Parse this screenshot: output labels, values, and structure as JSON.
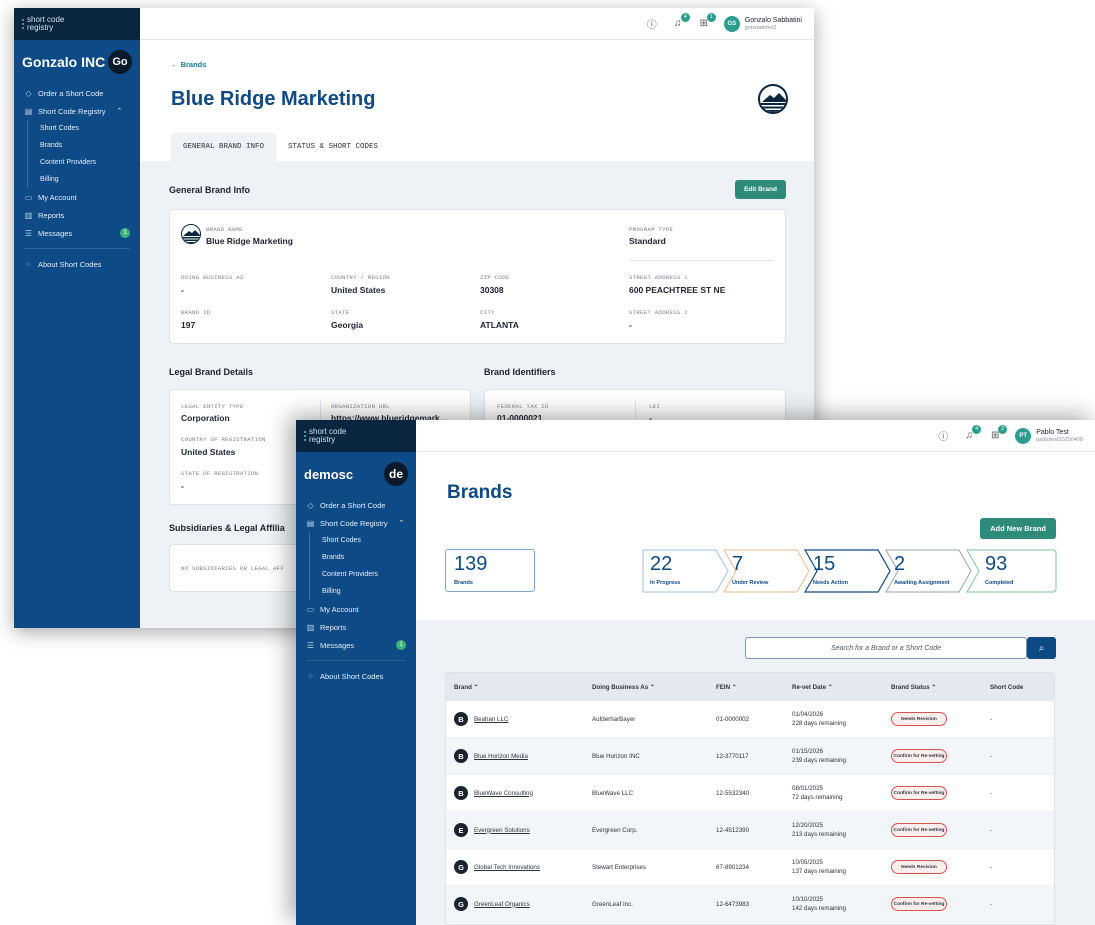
{
  "back_window": {
    "sidebar": {
      "logo_line1": "short code",
      "logo_line2": "registry",
      "org_name": "Gonzalo INC",
      "org_avatar": "Go",
      "nav": [
        {
          "label": "Order a Short Code",
          "icon": "tag-icon"
        },
        {
          "label": "Short Code Registry",
          "icon": "registry-icon"
        },
        {
          "label": "My Account",
          "icon": "chat-icon"
        },
        {
          "label": "Reports",
          "icon": "bar-chart-icon"
        },
        {
          "label": "Messages",
          "icon": "list-icon",
          "badge": "1"
        },
        {
          "label": "About Short Codes",
          "icon": "dots-icon"
        }
      ],
      "subnav": [
        "Short Codes",
        "Brands",
        "Content Providers",
        "Billing"
      ]
    },
    "header": {
      "notif_count": "4",
      "cart_count": "1",
      "user_initials": "GS",
      "user_name": "Gonzalo Sabbatini",
      "user_email": "gonzademo2"
    },
    "back_link": "← Brands",
    "title": "Blue Ridge Marketing",
    "tabs": [
      "GENERAL BRAND INFO",
      "STATUS & SHORT CODES"
    ],
    "general": {
      "section_title": "General Brand Info",
      "edit_button": "Edit Brand",
      "brand_name_label": "BRAND NAME",
      "brand_name": "Blue Ridge Marketing",
      "program_type_label": "PROGRAM TYPE",
      "program_type": "Standard",
      "fields": [
        {
          "label": "DOING BUSINESS AS",
          "value": "-"
        },
        {
          "label": "COUNTRY / REGION",
          "value": "United States"
        },
        {
          "label": "ZIP CODE",
          "value": "30308"
        },
        {
          "label": "STREET ADDRESS 1",
          "value": "600 PEACHTREE ST NE"
        },
        {
          "label": "BRAND ID",
          "value": "197"
        },
        {
          "label": "STATE",
          "value": "Georgia"
        },
        {
          "label": "CITY",
          "value": "ATLANTA"
        },
        {
          "label": "STREET ADDRESS 2",
          "value": "-"
        }
      ]
    },
    "legal": {
      "section_title": "Legal Brand Details",
      "fields": [
        {
          "label": "LEGAL ENTITY TYPE",
          "value": "Corporation"
        },
        {
          "label": "ORGANIZATION URL",
          "value": "https://www.blueridgemark..."
        },
        {
          "label": "COUNTRY OF REGISTRATION",
          "value": "United States"
        },
        {
          "label": "STATE OF REGISTRATION",
          "value": "-"
        }
      ]
    },
    "identifiers": {
      "section_title": "Brand Identifiers",
      "fields": [
        {
          "label": "FEDERAL TAX ID",
          "value": "01-0000021"
        },
        {
          "label": "LEI",
          "value": "-"
        }
      ]
    },
    "subsidiaries": {
      "section_title": "Subsidiaries & Legal Affilia",
      "empty_text": "NO SUBSIDIARIES OR LEGAL AFF"
    }
  },
  "front_window": {
    "sidebar": {
      "logo_line1": "short code",
      "logo_line2": "registry",
      "org_name": "demosc",
      "org_avatar": "de",
      "nav": [
        {
          "label": "Order a Short Code",
          "icon": "tag-icon"
        },
        {
          "label": "Short Code Registry",
          "icon": "registry-icon"
        },
        {
          "label": "My Account",
          "icon": "chat-icon"
        },
        {
          "label": "Reports",
          "icon": "bar-chart-icon"
        },
        {
          "label": "Messages",
          "icon": "list-icon",
          "badge": "1"
        },
        {
          "label": "About Short Codes",
          "icon": "dots-icon"
        }
      ],
      "subnav": [
        "Short Codes",
        "Brands",
        "Content Providers",
        "Billing"
      ]
    },
    "header": {
      "notif_count": "4",
      "cart_count": "2",
      "user_initials": "PT",
      "user_name": "Pablo Test",
      "user_email": "pablotest20250408"
    },
    "title": "Brands",
    "add_button": "Add New Brand",
    "stats": [
      {
        "number": "139",
        "label": "Brands",
        "color": "#7fa6cc"
      },
      {
        "number": "22",
        "label": "In Progress",
        "color": "#9ec3e0"
      },
      {
        "number": "7",
        "label": "Under Review",
        "color": "#e8b98f"
      },
      {
        "number": "15",
        "label": "Needs Action",
        "color": "#0d4a86"
      },
      {
        "number": "2",
        "label": "Awaiting Assignment",
        "color": "#9aa3ad"
      },
      {
        "number": "93",
        "label": "Completed",
        "color": "#7cc49a"
      }
    ],
    "search_placeholder": "Search for a Brand or a Short Code",
    "table": {
      "columns": [
        "Brand ⌃",
        "Doing Business As ⌃",
        "FEIN ⌃",
        "Re-vet Date ⌃",
        "Brand Status ⌃",
        "Short Code"
      ],
      "rows": [
        {
          "initial": "B",
          "brand": "Beahan LLC",
          "dba": "AufderharBayer",
          "fein": "01-0000002",
          "date": "01/04/2026",
          "remaining": "228 days remaining",
          "status": "Needs Revision",
          "code": "-"
        },
        {
          "initial": "B",
          "brand": "Blue Horizon Media",
          "dba": "Blue Horizon INC",
          "fein": "12-3770117",
          "date": "01/15/2026",
          "remaining": "239 days remaining",
          "status": "Confirm for Re-vetting",
          "code": "-"
        },
        {
          "initial": "B",
          "brand": "BlueWave Consulting",
          "dba": "BlueWave LLC",
          "fein": "12-5532340",
          "date": "08/01/2025",
          "remaining": "72 days remaining",
          "status": "Confirm for Re-vetting",
          "code": "-"
        },
        {
          "initial": "E",
          "brand": "Evergreen Solutions",
          "dba": "Evergreen Corp.",
          "fein": "12-4512390",
          "date": "12/20/2025",
          "remaining": "213 days remaining",
          "status": "Confirm for Re-vetting",
          "code": "-"
        },
        {
          "initial": "G",
          "brand": "Global Tech Innovations",
          "dba": "Stewart Enterprises",
          "fein": "67-8901234",
          "date": "10/05/2025",
          "remaining": "137 days remaining",
          "status": "Needs Revision",
          "code": "-"
        },
        {
          "initial": "G",
          "brand": "GreenLeaf Organics",
          "dba": "GreenLeaf Inc.",
          "fein": "12-6473983",
          "date": "10/10/2025",
          "remaining": "142 days remaining",
          "status": "Confirm for Re-vetting",
          "code": "-"
        }
      ]
    }
  }
}
